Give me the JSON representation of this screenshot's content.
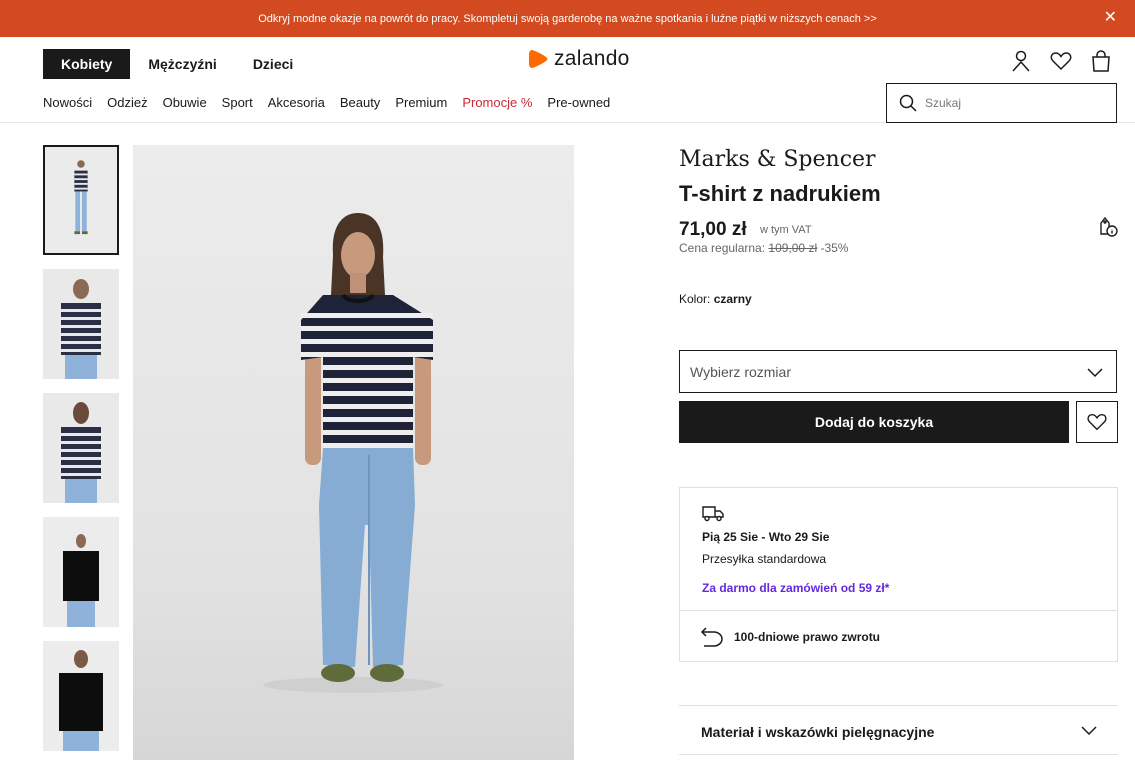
{
  "banner": {
    "text": "Odkryj modne okazje na powrót do pracy. Skompletuj swoją garderobę na ważne spotkania i luźne piątki w niższych cenach >>",
    "close": "✕"
  },
  "header": {
    "gender_tabs": [
      "Kobiety",
      "Mężczyźni",
      "Dzieci"
    ],
    "logo": "zalando",
    "categories": [
      "Nowości",
      "Odzież",
      "Obuwie",
      "Sport",
      "Akcesoria",
      "Beauty",
      "Premium",
      "Promocje %",
      "Pre-owned"
    ],
    "search_placeholder": "Szukaj"
  },
  "product": {
    "brand": "Marks & Spencer",
    "title": "T-shirt z nadrukiem",
    "price": "71,00 zł",
    "vat": "w tym VAT",
    "regular_label": "Cena regularna:",
    "regular_price": "109,00 zł",
    "discount": "-35%",
    "color_label": "Kolor:",
    "color_value": "czarny",
    "size_placeholder": "Wybierz rozmiar",
    "add_to_cart": "Dodaj do koszyka"
  },
  "delivery": {
    "date": "Pią 25 Sie - Wto 29 Sie",
    "type": "Przesyłka standardowa",
    "free": "Za darmo dla zamówień od 59 zł*",
    "returns": "100-dniowe prawo zwrotu"
  },
  "accordion": {
    "material": "Materiał i wskazówki pielęgnacyjne"
  },
  "colors": {
    "banner": "#d34a20",
    "accent_orange": "#ff6900",
    "promo_red": "#c52a36",
    "free_purple": "#6328e0",
    "dark": "#1a1a1a"
  },
  "icons": [
    "close-icon",
    "zalando-logo-icon",
    "user-icon",
    "heart-icon",
    "bag-icon",
    "search-icon",
    "price-tag-info-icon",
    "chevron-down-icon",
    "truck-icon",
    "return-arrow-icon"
  ]
}
